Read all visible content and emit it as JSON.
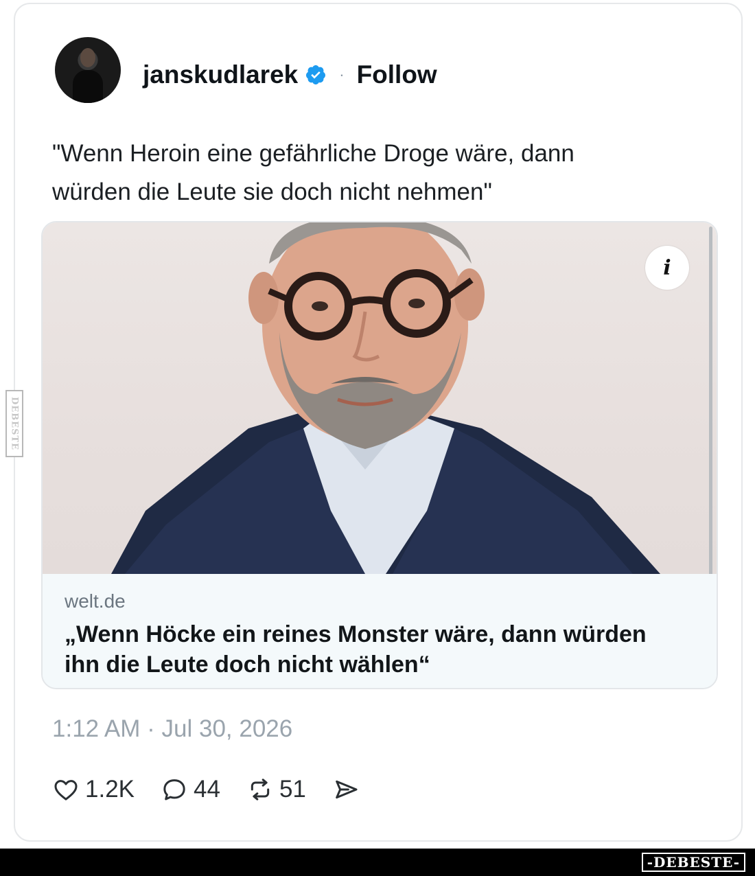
{
  "post": {
    "username": "janskudlarek",
    "separator": "·",
    "follow_label": "Follow",
    "text": "\"Wenn Heroin eine gefährliche Droge wäre, dann\nwürden die Leute sie doch nicht nehmen\"",
    "timestamp": "1:12 AM · Jul 30, 2026"
  },
  "link_card": {
    "info_icon": "i",
    "domain": "welt.de",
    "title": "„Wenn Höcke ein reines Monster wäre, dann würden\nihn die Leute doch nicht wählen“"
  },
  "actions": {
    "likes": "1.2K",
    "replies": "44",
    "reposts": "51"
  },
  "watermark": {
    "side": "DEBESTE",
    "bottom": "-DEBESTE-"
  },
  "colors": {
    "verified": "#1d9bf0",
    "muted": "#9aa4ad",
    "link_meta_bg": "#f4f9fb"
  }
}
